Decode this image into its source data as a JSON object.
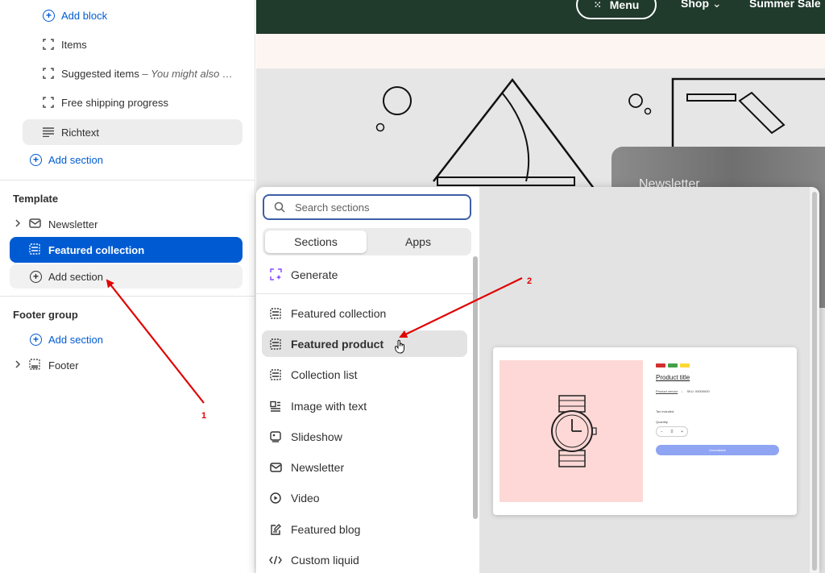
{
  "sidebar": {
    "add_block": "Add block",
    "blocks": [
      {
        "label": "Items",
        "note": ""
      },
      {
        "label": "Suggested items",
        "note": " – You might also …"
      },
      {
        "label": "Free shipping progress",
        "note": ""
      },
      {
        "label": "Richtext",
        "note": ""
      }
    ],
    "add_section_top": "Add section",
    "template_heading": "Template",
    "template_items": [
      {
        "label": "Newsletter"
      },
      {
        "label": "Featured collection"
      }
    ],
    "add_section_template": "Add section",
    "footer_heading": "Footer group",
    "add_section_footer": "Add section",
    "footer_item": "Footer"
  },
  "storefront": {
    "menu_label": "Menu",
    "shop_label": "Shop",
    "summer_label": "Summer Sale",
    "newsletter_label": "Newsletter"
  },
  "popup": {
    "search_placeholder": "Search sections",
    "tabs": [
      "Sections",
      "Apps"
    ],
    "generate_label": "Generate",
    "items": [
      "Featured collection",
      "Featured product",
      "Collection list",
      "Image with text",
      "Slideshow",
      "Newsletter",
      "Video",
      "Featured blog",
      "Custom liquid"
    ],
    "preview": {
      "product_title": "Product title",
      "vendor": "Product vendor",
      "sku": "SKU: 00000000",
      "tax_note": "Tax included.",
      "quantity_label": "Quantity",
      "quantity_minus": "−",
      "quantity_value": "0",
      "quantity_plus": "+",
      "buy_label": "Unavailable",
      "badge_colors": [
        "#d32f2f",
        "#43a047",
        "#fdd835"
      ]
    }
  },
  "annotations": {
    "label_1": "1",
    "label_2": "2",
    "arrow_color": "#e00000"
  },
  "colors": {
    "accent": "#005bd3",
    "selected_bg": "#005bd3",
    "header_bg": "#203a2c",
    "generate_icon": "#8a4dff"
  }
}
